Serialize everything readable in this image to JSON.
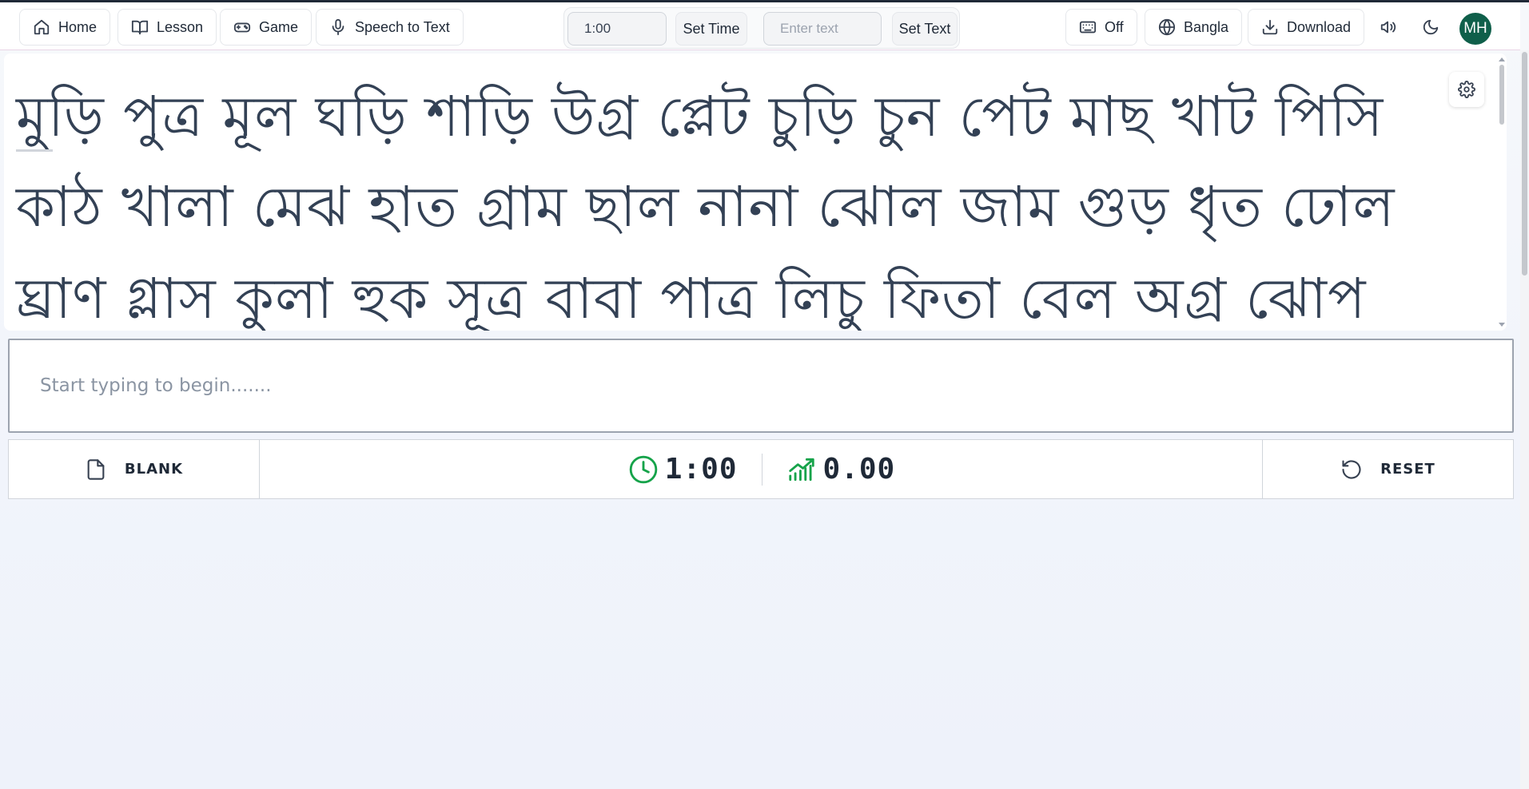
{
  "nav": {
    "home": "Home",
    "lesson": "Lesson",
    "game": "Game",
    "speech": "Speech to Text",
    "time_value": "1:00",
    "set_time": "Set Time",
    "text_placeholder": "Enter text",
    "set_text": "Set Text",
    "keyboard": "Off",
    "language": "Bangla",
    "download": "Download",
    "avatar": "MH"
  },
  "text_display": {
    "lines": [
      "মুড়ি পুত্র মূল ঘড়ি শাড়ি উগ্র প্লেট চুড়ি চুন পেট মাছ খাট পিসি",
      "কাঠ খালা মেঝ হাত গ্রাম ছাল নানা ঝোল জাম গুড় ধৃত ঢোল",
      "ঘ্রাণ গ্লাস কুলা হুক সূত্র বাবা পাত্র লিচু ফিতা বেল অগ্র ঝোপ"
    ]
  },
  "typing": {
    "placeholder": "Start typing to begin......."
  },
  "bottom": {
    "blank": "BLANK",
    "timer": "1:00",
    "score": "0.00",
    "reset": "RESET"
  },
  "colors": {
    "accent": "#16a34a",
    "avatar_bg": "#0f5f4a",
    "text": "#334155"
  }
}
